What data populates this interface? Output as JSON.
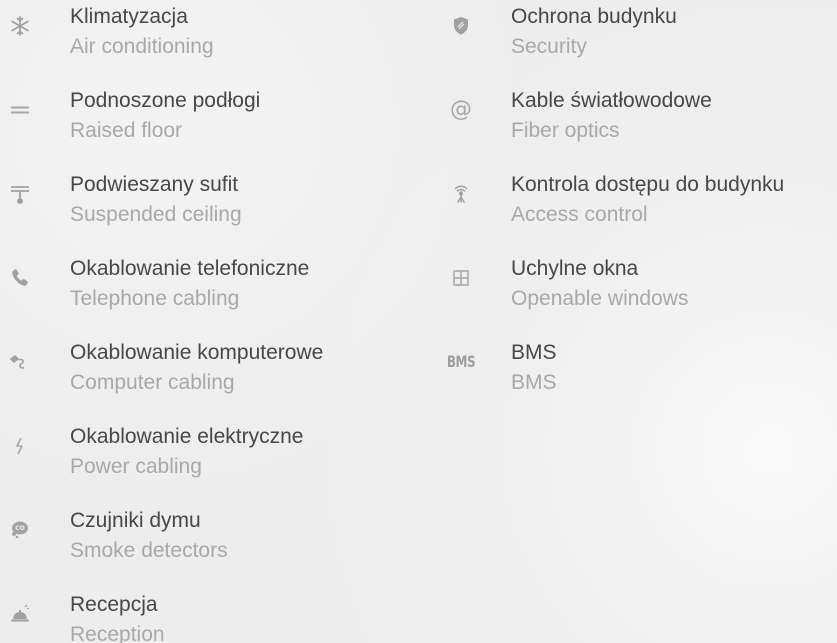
{
  "features_left": [
    {
      "icon": "snowflake-icon",
      "pl": "Klimatyzacja",
      "en": "Air conditioning"
    },
    {
      "icon": "raised-floor-icon",
      "pl": "Podnoszone podłogi",
      "en": "Raised floor"
    },
    {
      "icon": "suspended-ceiling-icon",
      "pl": "Podwieszany sufit",
      "en": "Suspended ceiling"
    },
    {
      "icon": "phone-icon",
      "pl": "Okablowanie telefoniczne",
      "en": "Telephone cabling"
    },
    {
      "icon": "computer-cable-icon",
      "pl": "Okablowanie komputerowe",
      "en": "Computer cabling"
    },
    {
      "icon": "lightning-icon",
      "pl": "Okablowanie elektryczne",
      "en": "Power cabling"
    },
    {
      "icon": "smoke-detector-icon",
      "pl": "Czujniki dymu",
      "en": "Smoke detectors"
    },
    {
      "icon": "reception-bell-icon",
      "pl": "Recepcja",
      "en": "Reception"
    }
  ],
  "features_right": [
    {
      "icon": "shield-icon",
      "pl": "Ochrona budynku",
      "en": "Security"
    },
    {
      "icon": "at-sign-icon",
      "pl": "Kable światłowodowe",
      "en": "Fiber optics"
    },
    {
      "icon": "access-antenna-icon",
      "pl": "Kontrola dostępu do budynku",
      "en": "Access control"
    },
    {
      "icon": "window-icon",
      "pl": "Uchylne okna",
      "en": "Openable windows"
    },
    {
      "icon": "bms-icon",
      "pl": "BMS",
      "en": "BMS",
      "icon_text": "BMS"
    }
  ]
}
